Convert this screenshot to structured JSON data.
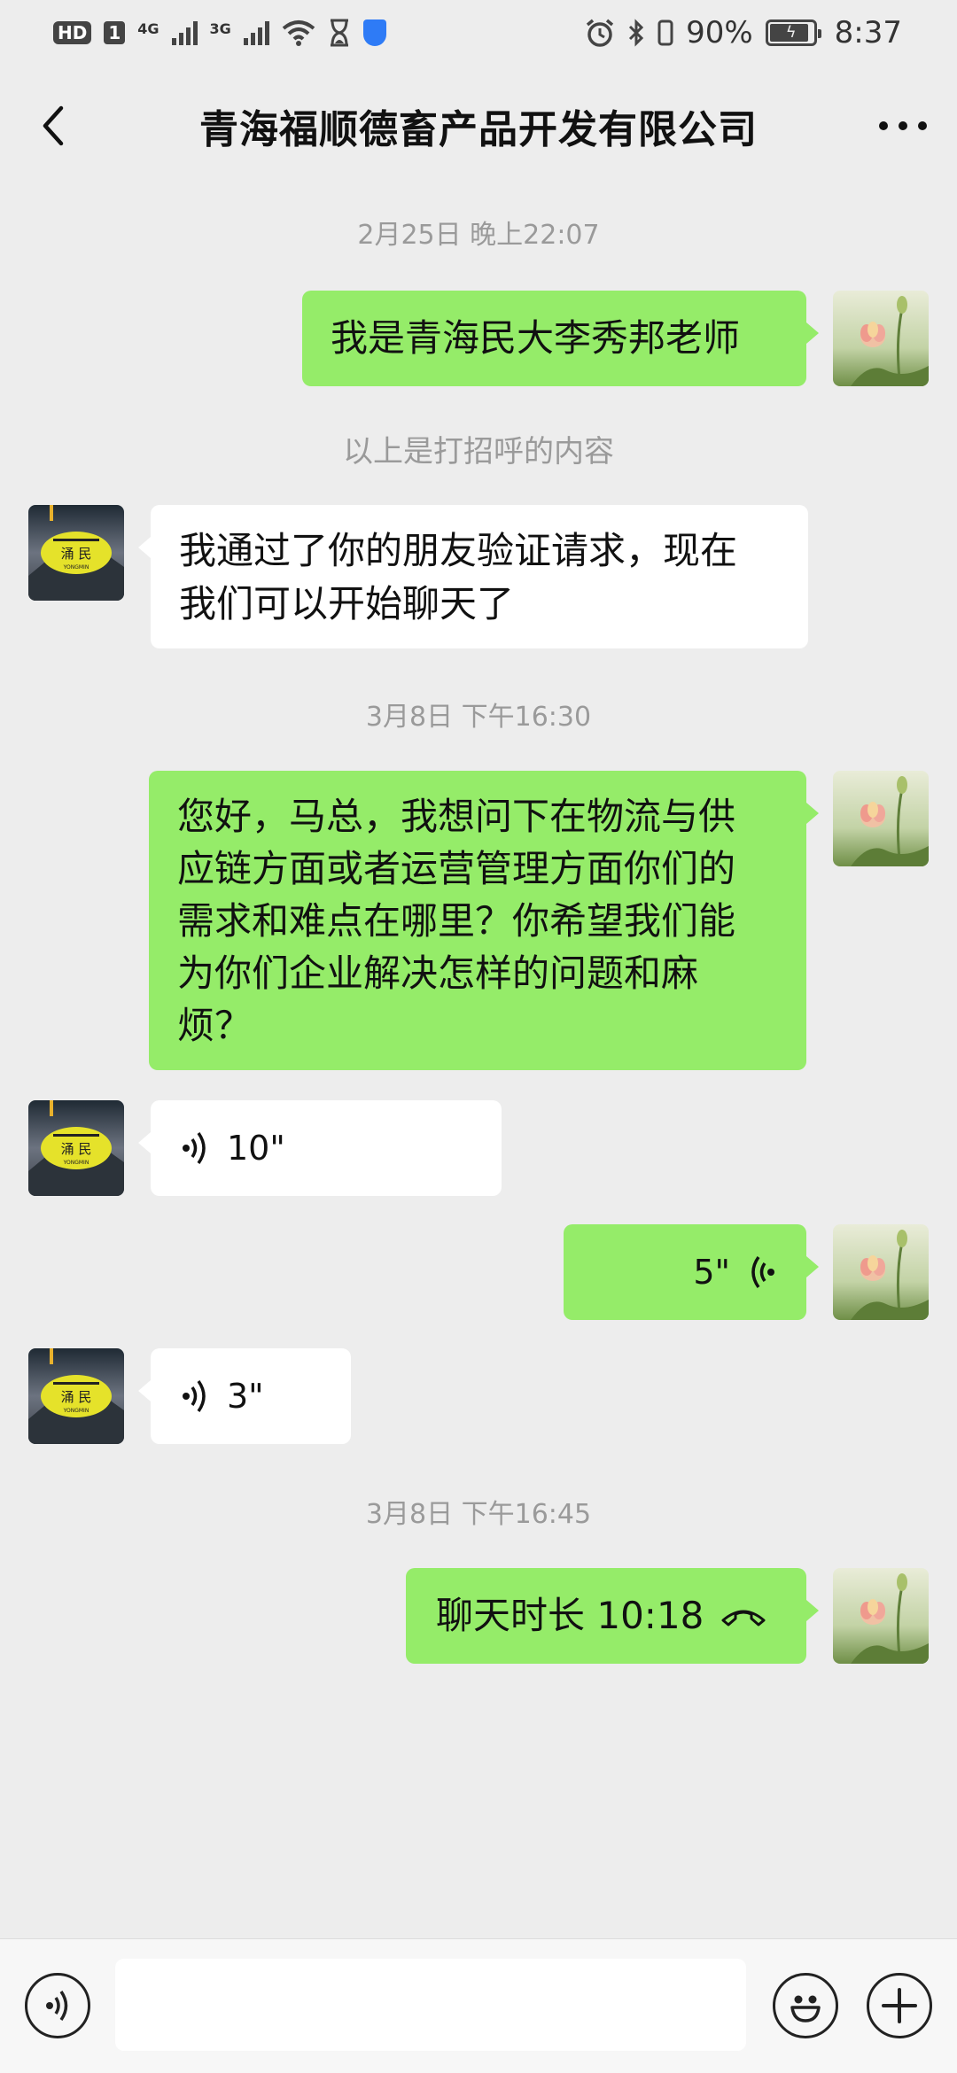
{
  "status_bar": {
    "hd": "HD",
    "sim": "1",
    "net1": "4G",
    "net2": "3G",
    "battery": "90%",
    "battery_level": 0.9,
    "time": "8:37"
  },
  "header": {
    "title": "青海福顺德畜产品开发有限公司",
    "back_icon": "chevron-left-icon",
    "more_icon": "more-horizontal-icon"
  },
  "messages": {
    "ts1": "2月25日 晚上22:07",
    "msg1": "我是青海民大李秀邦老师",
    "sys1": "以上是打招呼的内容",
    "msg2_line1": "我通过了你的朋友验证请求，现在",
    "msg2_line2": "我们可以开始聊天了",
    "ts2": "3月8日 下午16:30",
    "msg3_line1": "您好，马总，我想问下在物流与供",
    "msg3_line2": "应链方面或者运营管理方面你们的",
    "msg3_line3": "需求和难点在哪里？你希望我们能",
    "msg3_line4": "为你们企业解决怎样的问题和麻",
    "msg3_line5": "烦？",
    "voice1": "10\"",
    "voice2": "5\"",
    "voice3": "3\"",
    "ts3": "3月8日 下午16:45",
    "call": "聊天时长 10:18"
  },
  "contact_avatar_text": "涌 民",
  "contact_avatar_subtext": "YONGMIN",
  "colors": {
    "background": "#ededed",
    "my_bubble": "#95ec69",
    "their_bubble": "#ffffff"
  },
  "input_bar": {
    "voice_icon": "voice-mode-icon",
    "emoji_icon": "emoji-icon",
    "plus_icon": "plus-icon"
  }
}
